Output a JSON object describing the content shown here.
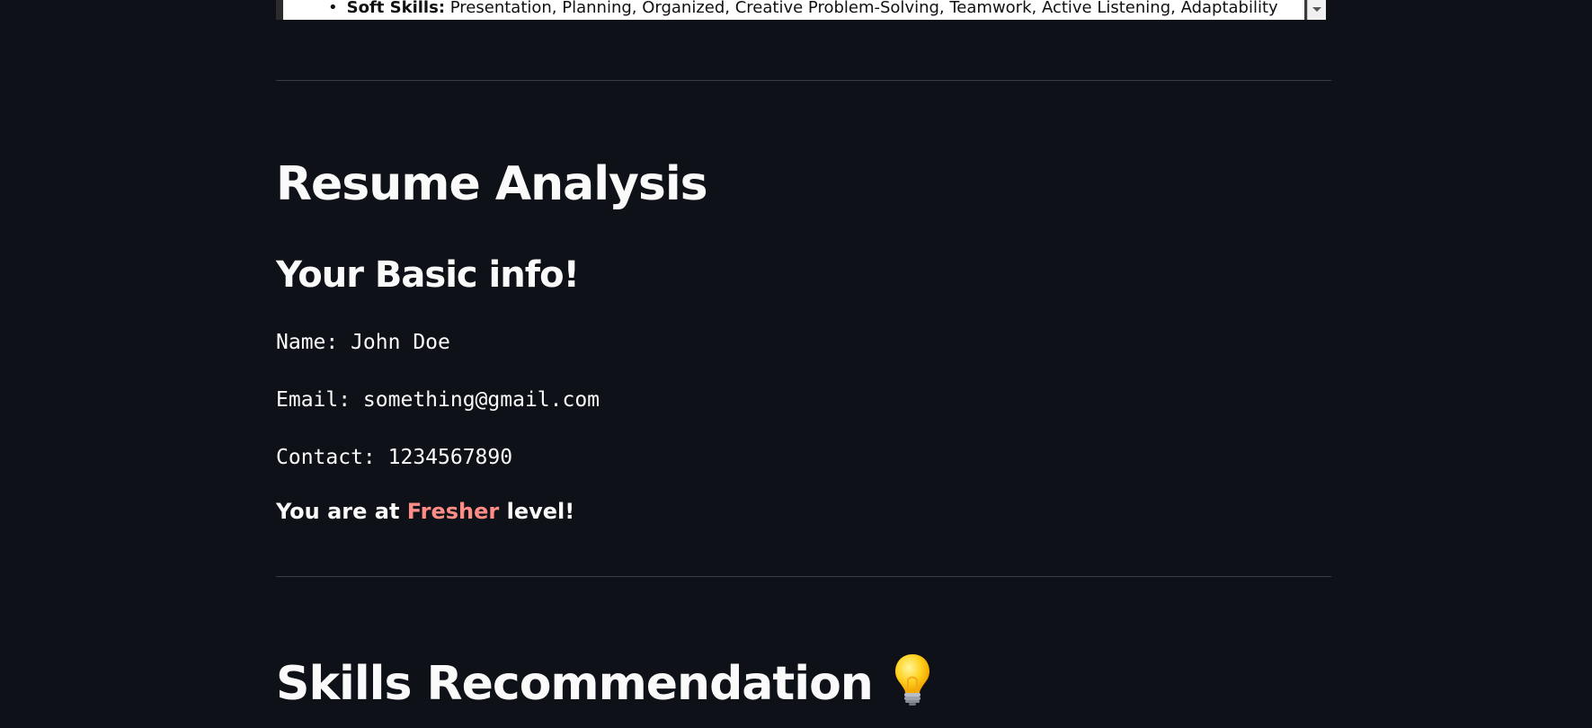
{
  "pdf_preview": {
    "bullet": "•",
    "label": "Soft Skills:",
    "text": "Presentation, Planning, Organized, Creative Problem-Solving, Teamwork, Active Listening, Adaptability"
  },
  "analysis": {
    "title": "Resume Analysis",
    "subtitle": "Your Basic info!",
    "name_line": "Name: John Doe",
    "email_line": "Email: something@gmail.com",
    "contact_line": "Contact: 1234567890",
    "level_prefix": "You are at ",
    "level_value": "Fresher",
    "level_suffix": " level!"
  },
  "skills": {
    "title": "Skills Recommendation",
    "icon": "lightbulb-icon"
  },
  "colors": {
    "background": "#0e1117",
    "text": "#fafafa",
    "accent": "#ff8c86",
    "divider": "#3a3d45"
  }
}
